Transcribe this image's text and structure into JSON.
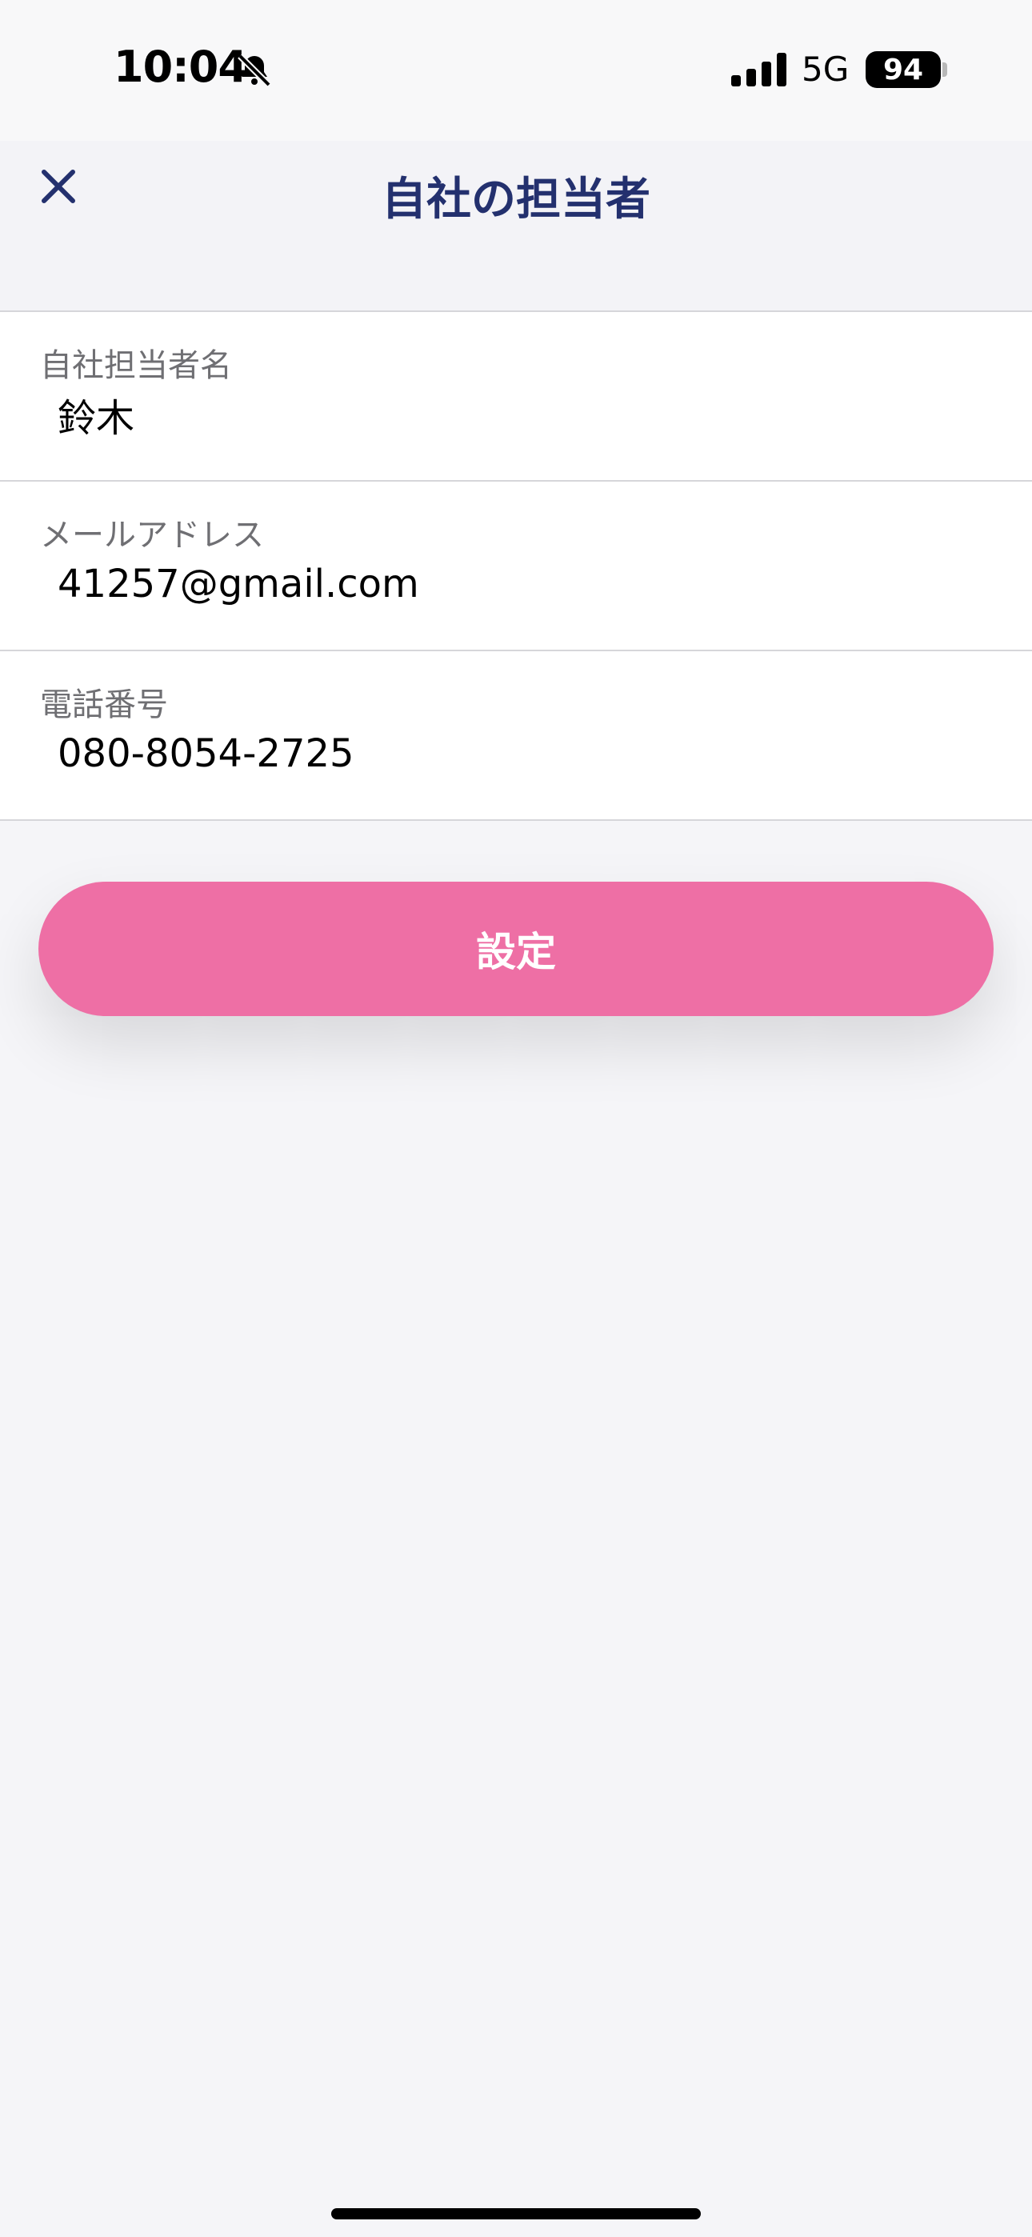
{
  "status_bar": {
    "time": "10:04",
    "network": "5G",
    "battery": "94",
    "icons": [
      "bell-slash-icon",
      "cellular-signal-icon",
      "battery-icon"
    ]
  },
  "header": {
    "title": "自社の担当者",
    "close_icon": "close-icon"
  },
  "form": {
    "fields": [
      {
        "label": "自社担当者名",
        "value": "鈴木"
      },
      {
        "label": "メールアドレス",
        "value": "41257@gmail.com"
      },
      {
        "label": "電話番号",
        "value": "080-8054-2725"
      }
    ]
  },
  "actions": {
    "submit_label": "設定"
  },
  "colors": {
    "title": "#23306e",
    "accent": "#ee6fa5",
    "label": "#6f6f73",
    "background": "#f5f5f8"
  }
}
